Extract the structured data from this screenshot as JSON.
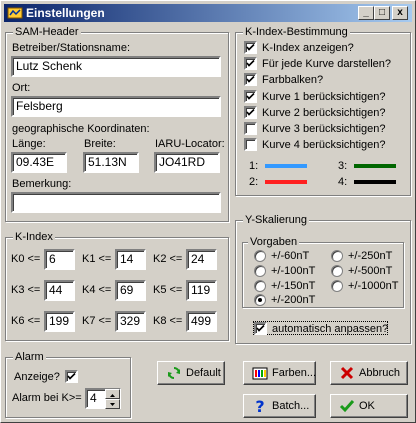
{
  "title": "Einstellungen",
  "window_buttons": {
    "minimize": "_",
    "maximize": "□",
    "close": "x"
  },
  "sam_header": {
    "legend": "SAM-Header",
    "operator_label": "Betreiber/Stationsname:",
    "operator_value": "Lutz Schenk",
    "location_label": "Ort:",
    "location_value": "Felsberg",
    "coords_label": "geographische Koordinaten:",
    "length_label": "Länge:",
    "length_value": "09.43E",
    "width_label": "Breite:",
    "width_value": "51.13N",
    "iaru_label": "IARU-Locator:",
    "iaru_value": "JO41RD",
    "remark_label": "Bemerkung:",
    "remark_value": ""
  },
  "kindex_curves": {
    "legend": "K-Index-Bestimmung",
    "options": [
      {
        "label": "K-Index  anzeigen?",
        "checked": true
      },
      {
        "label": "Für jede Kurve darstellen?",
        "checked": true
      },
      {
        "label": "Farbbalken?",
        "checked": true
      },
      {
        "label": "Kurve 1 berücksichtigen?",
        "checked": true
      },
      {
        "label": "Kurve 2 berücksichtigen?",
        "checked": true
      },
      {
        "label": "Kurve 3 berücksichtigen?",
        "checked": false
      },
      {
        "label": "Kurve 4 berücksichtigen?",
        "checked": false
      }
    ],
    "curves": [
      {
        "label": "1:",
        "color": "#3399ff"
      },
      {
        "label": "2:",
        "color": "#ff2020"
      },
      {
        "label": "3:",
        "color": "#006600"
      },
      {
        "label": "4:",
        "color": "#000000"
      }
    ]
  },
  "kindex": {
    "legend": "K-Index",
    "thresholds": [
      {
        "label": "K0 <=",
        "value": "6"
      },
      {
        "label": "K1 <=",
        "value": "14"
      },
      {
        "label": "K2 <=",
        "value": "24"
      },
      {
        "label": "K3 <=",
        "value": "44"
      },
      {
        "label": "K4 <=",
        "value": "69"
      },
      {
        "label": "K5 <=",
        "value": "119"
      },
      {
        "label": "K6 <=",
        "value": "199"
      },
      {
        "label": "K7 <=",
        "value": "329"
      },
      {
        "label": "K8 <=",
        "value": "499"
      }
    ]
  },
  "yscale": {
    "legend": "Y-Skalierung",
    "vorgaben_legend": "Vorgaben",
    "options": [
      {
        "label": "+/-60nT",
        "selected": false
      },
      {
        "label": "+/-100nT",
        "selected": false
      },
      {
        "label": "+/-150nT",
        "selected": false
      },
      {
        "label": "+/-200nT",
        "selected": true
      },
      {
        "label": "+/-250nT",
        "selected": false
      },
      {
        "label": "+/-500nT",
        "selected": false
      },
      {
        "label": "+/-1000nT",
        "selected": false
      }
    ],
    "auto_label": "automatisch anpassen?",
    "auto_checked": true
  },
  "alarm": {
    "legend": "Alarm",
    "show_label": "Anzeige?",
    "show_checked": true,
    "threshold_label": "Alarm bei K>=",
    "threshold_value": "4"
  },
  "buttons": {
    "default": "Default",
    "colors": "Farben...",
    "cancel": "Abbruch",
    "batch": "Batch...",
    "ok": "OK"
  }
}
